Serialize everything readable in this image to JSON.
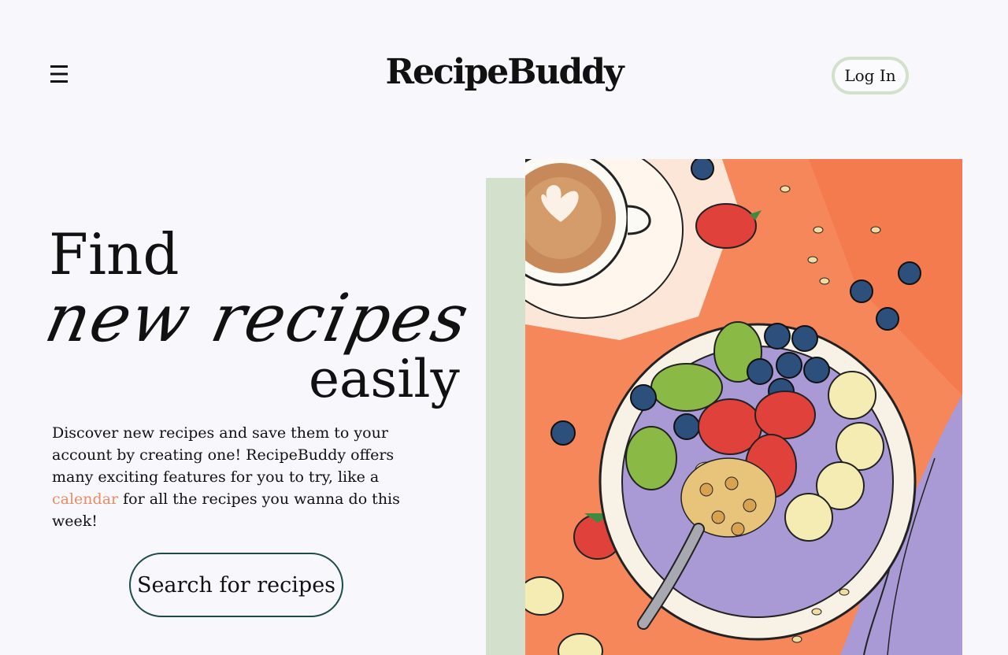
{
  "header": {
    "logo": "RecipeBuddy",
    "login_label": "Log In",
    "menu_icon": "hamburger-menu-icon"
  },
  "hero": {
    "line1": "Find",
    "line2": "new recipes",
    "line3": "easily",
    "description_before": "Discover new recipes and save them to your account by creating one! RecipeBuddy offers many exciting features for you to try, like a ",
    "description_link": "calendar",
    "description_after": " for all the recipes you wanna do this week!",
    "search_button": "Search for recipes"
  },
  "colors": {
    "background": "#f8f8fc",
    "accent_green": "#d3e0cb",
    "link_orange": "#ec8a62",
    "button_border": "#1f4a4a",
    "illustration_orange": "#f5875a",
    "bowl_purple": "#a99ad6"
  }
}
